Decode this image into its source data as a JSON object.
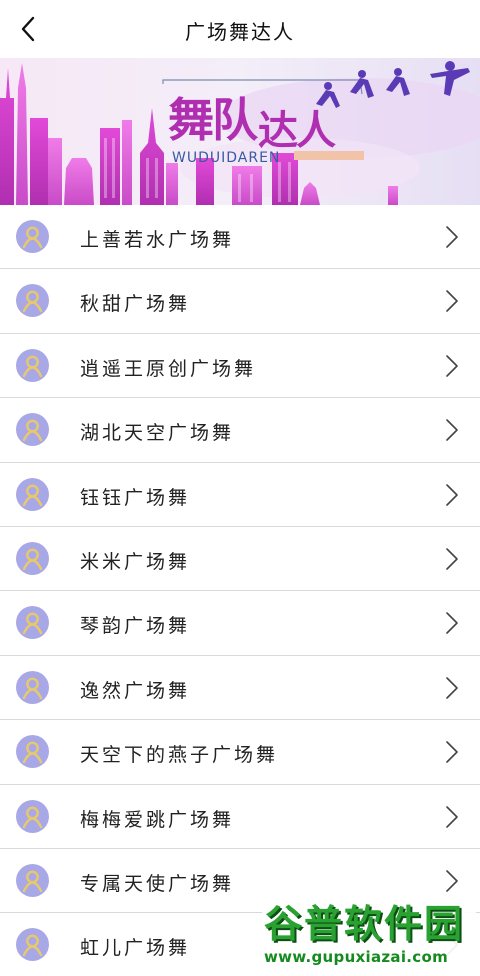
{
  "header": {
    "title": "广场舞达人",
    "back_icon": "chevron-left-icon"
  },
  "banner": {
    "title": "舞队达人",
    "subtitle": "WUDUIDAREN",
    "accent": "#b02fb0"
  },
  "teams": [
    {
      "label": "上善若水广场舞"
    },
    {
      "label": "秋甜广场舞"
    },
    {
      "label": "逍遥王原创广场舞"
    },
    {
      "label": "湖北天空广场舞"
    },
    {
      "label": "钰钰广场舞"
    },
    {
      "label": "米米广场舞"
    },
    {
      "label": "琴韵广场舞"
    },
    {
      "label": "逸然广场舞"
    },
    {
      "label": "天空下的燕子广场舞"
    },
    {
      "label": "梅梅爱跳广场舞"
    },
    {
      "label": "专属天使广场舞"
    },
    {
      "label": "虹儿广场舞"
    }
  ],
  "colors": {
    "avatar_bg": "#a9a8e6",
    "avatar_fg": "#e8c96a",
    "divider": "#d9d9d9"
  },
  "watermark": {
    "text": "谷普软件园",
    "url": "www.gupuxiazai.com"
  }
}
